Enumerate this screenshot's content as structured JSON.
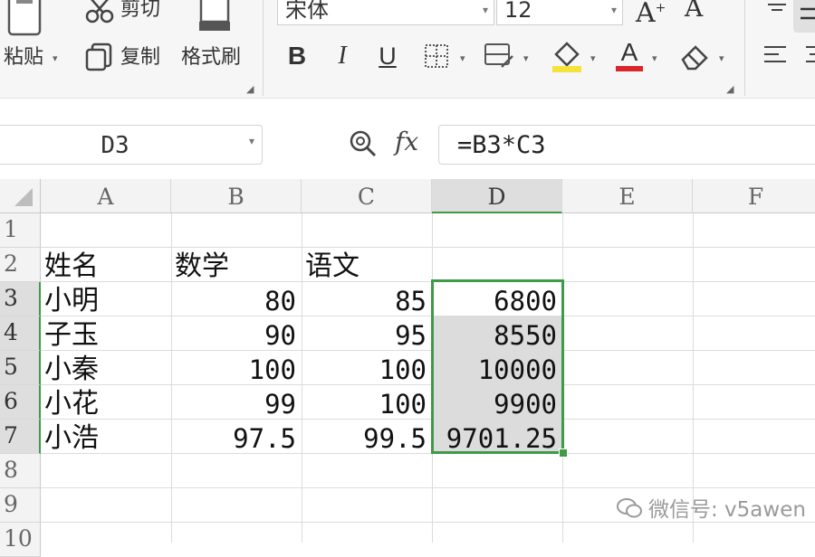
{
  "ribbon": {
    "clipboard": {
      "paste_label": "粘贴",
      "cut_label": "剪切",
      "copy_label": "复制",
      "format_painter_label": "格式刷"
    },
    "font": {
      "font_name": "宋体",
      "font_size": "12",
      "increase_size": "A",
      "decrease_size": "A",
      "bold": "B",
      "italic": "I",
      "underline": "U",
      "font_color_letter": "A",
      "font_color": "#d9262b",
      "fill_color": "#f5e33a"
    }
  },
  "formula_bar": {
    "name_box": "D3",
    "fx_label": "fx",
    "formula": "=B3*C3"
  },
  "sheet": {
    "columns": [
      "A",
      "B",
      "C",
      "D",
      "E",
      "F"
    ],
    "rows": [
      "1",
      "2",
      "3",
      "4",
      "5",
      "6",
      "7",
      "8",
      "9",
      "10"
    ],
    "selected_column": "D",
    "selected_range": "D3:D7",
    "cells": {
      "A2": "姓名",
      "B2": "数学",
      "C2": "语文",
      "A3": "小明",
      "B3": "80",
      "C3": "85",
      "D3": "6800",
      "A4": "子玉",
      "B4": "90",
      "C4": "95",
      "D4": "8550",
      "A5": "小秦",
      "B5": "100",
      "C5": "100",
      "D5": "10000",
      "A6": "小花",
      "B6": "99",
      "C6": "100",
      "D6": "9900",
      "A7": "小浩",
      "B7": "97.5",
      "C7": "99.5",
      "D7": "9701.25"
    }
  },
  "watermark": "微信号: v5awen",
  "accent_color": "#3f9a4a"
}
